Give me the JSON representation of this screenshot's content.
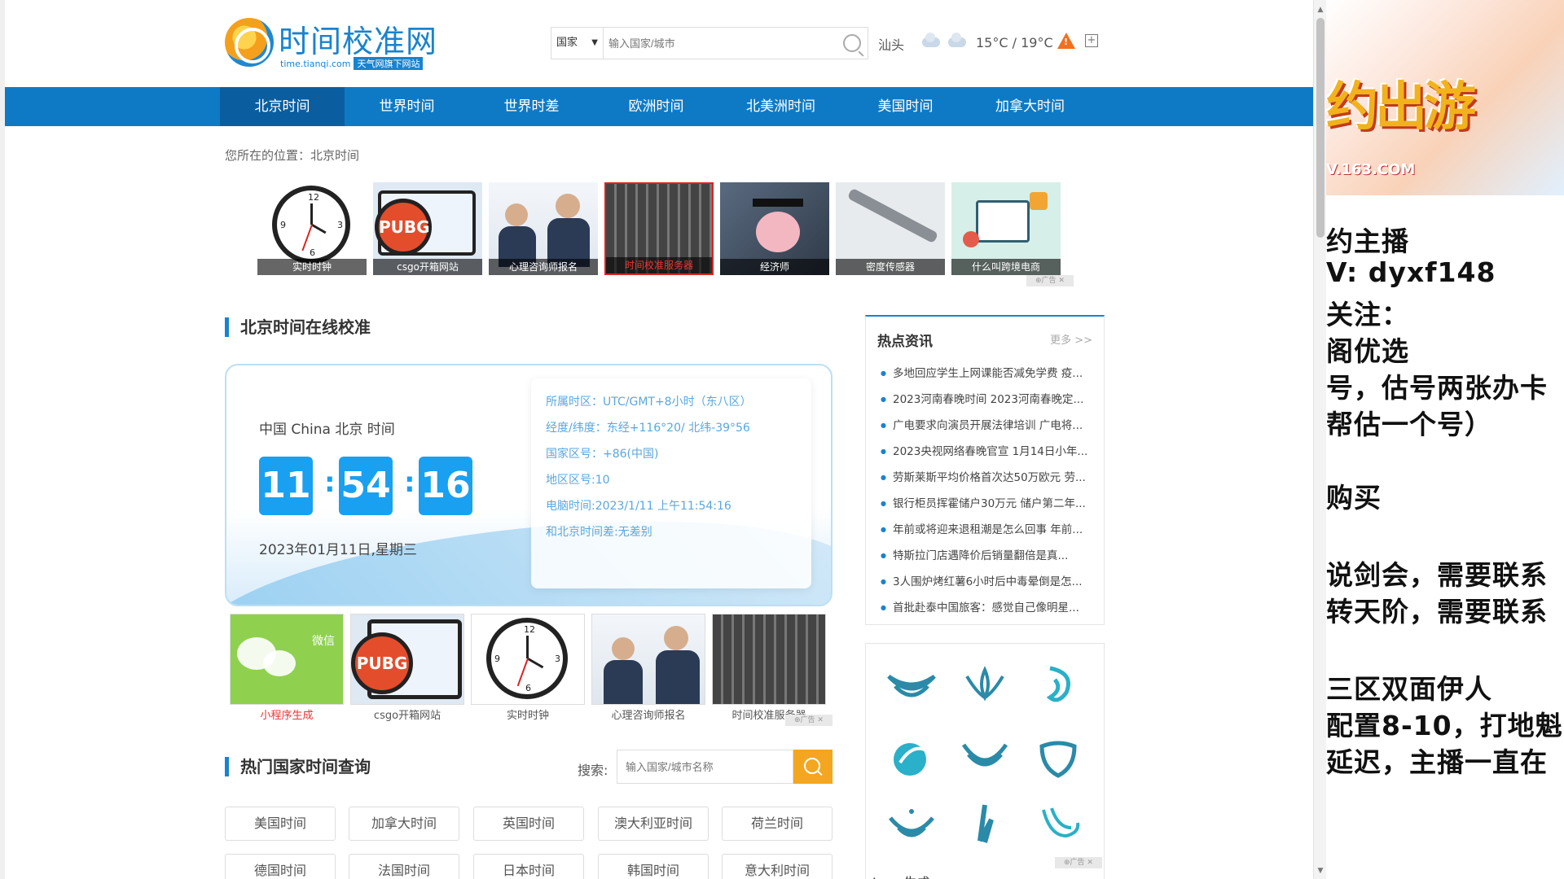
{
  "header": {
    "logo_title": "时间校准网",
    "logo_url": "time.tianqi.com",
    "logo_badge": "天气网旗下网站",
    "search_country": "国家",
    "search_placeholder": "输入国家/城市",
    "city": "汕头",
    "temp": "15°C / 19°C"
  },
  "nav": [
    "北京时间",
    "世界时间",
    "世界时差",
    "欧洲时间",
    "北美洲时间",
    "美国时间",
    "加拿大时间"
  ],
  "breadcrumb": "您所在的位置：北京时间",
  "top_thumbs": [
    "实时时钟",
    "csgo开箱网站",
    "心理咨询师报名",
    "时间校准服务器",
    "经济师",
    "密度传感器",
    "什么叫跨境电商"
  ],
  "ad_mark": "⊕广告 ✕",
  "section_clock_title": "北京时间在线校准",
  "clock_card": {
    "label": "中国 China 北京 时间",
    "hh": "11",
    "mm": "54",
    "ss": "16",
    "date": "2023年01月11日,星期三",
    "info": [
      "所属时区：UTC/GMT+8小时（东八区）",
      "经度/纬度：东经+116°20/ 北纬-39°56",
      "国家区号：+86(中国)",
      "地区区号:10",
      "电脑时间:2023/1/11 上午11:54:16",
      "和北京时间差:无差别"
    ]
  },
  "bottom_thumbs": [
    "小程序生成",
    "csgo开箱网站",
    "实时时钟",
    "心理咨询师报名",
    "时间校准服务器"
  ],
  "wechat_text": "微信",
  "section_country_title": "热门国家时间查询",
  "search2_label": "搜索:",
  "search2_placeholder": "输入国家/城市名称",
  "countries_row1": [
    "美国时间",
    "加拿大时间",
    "英国时间",
    "澳大利亚时间",
    "荷兰时间"
  ],
  "countries_row2": [
    "德国时间",
    "法国时间",
    "日本时间",
    "韩国时间",
    "意大利时间"
  ],
  "news": {
    "title": "热点资讯",
    "more": "更多 >>",
    "items": [
      "多地回应学生上网课能否减免学费 疫...",
      "2023河南春晚时间 2023河南春晚定...",
      "广电要求向演员开展法律培训 广电将...",
      "2023央视网络春晚官宣 1月14日小年...",
      "劳斯莱斯平均价格首次达50万欧元 劳...",
      "银行柜员挥霍储户30万元 储户第二年...",
      "年前或将迎来退租潮是怎么回事 年前...",
      "特斯拉门店遇降价后销量翻倍是真...",
      "3人围炉烤红薯6小时后中毒晕倒是怎...",
      "首批赴泰中国旅客：感觉自己像明星..."
    ]
  },
  "logo_gen": "Logo生成",
  "side_ad": {
    "logo_text": "约出游",
    "url": "V.163.COM",
    "lines": [
      "约主播",
      "V: dyxf148",
      "关注：",
      "阁优选",
      "号，估号两张办卡",
      "帮估一个号）",
      "",
      "购买",
      "",
      "说剑会，需要联系",
      "转天阶，需要联系",
      "",
      "三区双面伊人",
      "配置8-10，打地魁",
      "延迟，主播一直在"
    ]
  },
  "colors": {
    "brand_blue": "#0e7ac6",
    "digit_blue": "#1aa0f0",
    "accent_orange": "#f4a620"
  }
}
